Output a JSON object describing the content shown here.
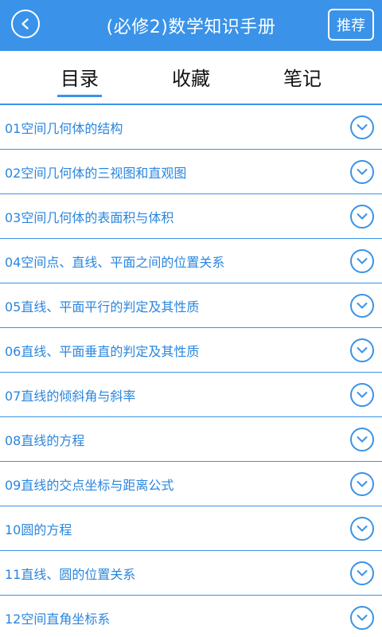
{
  "header": {
    "title": "(必修2)数学知识手册",
    "recommend_label": "推荐"
  },
  "tabs": [
    {
      "label": "目录",
      "active": true
    },
    {
      "label": "收藏",
      "active": false
    },
    {
      "label": "笔记",
      "active": false
    }
  ],
  "catalog": [
    "01空间几何体的结构",
    "02空间几何体的三视图和直观图",
    "03空间几何体的表面积与体积",
    "04空间点、直线、平面之间的位置关系",
    "05直线、平面平行的判定及其性质",
    "06直线、平面垂直的判定及其性质",
    "07直线的倾斜角与斜率",
    "08直线的方程",
    "09直线的交点坐标与距离公式",
    "10圆的方程",
    "11直线、圆的位置关系",
    "12空间直角坐标系"
  ],
  "colors": {
    "accent": "#3a93e8",
    "item_text": "#2a86de"
  }
}
